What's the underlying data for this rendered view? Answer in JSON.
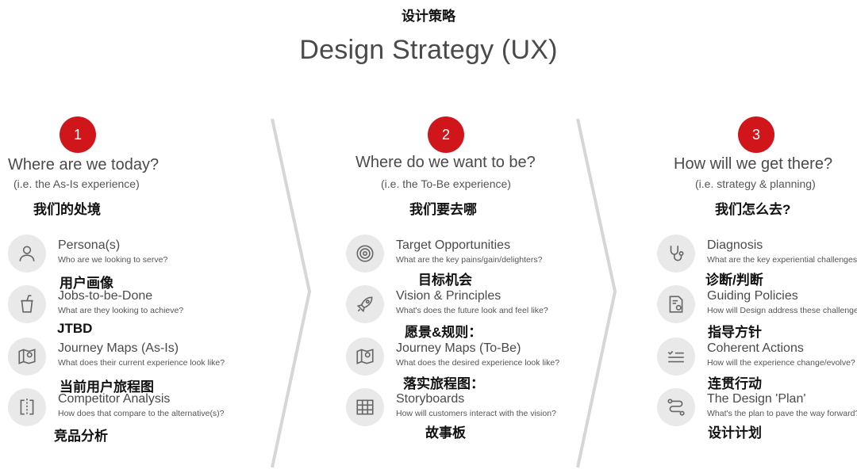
{
  "header": {
    "cn_title": "设计策略",
    "title": "Design Strategy (UX)"
  },
  "columns": [
    {
      "number": "1",
      "title": "Where are we today?",
      "subtitle": "(i.e. the As-Is experience)",
      "cn": "我们的处境",
      "items": [
        {
          "icon": "person-icon",
          "label": "Persona(s)",
          "desc": "Who are we looking to serve?",
          "cn": "用户画像"
        },
        {
          "icon": "cup-icon",
          "label": "Jobs-to-be-Done",
          "desc": "What are they looking to achieve?",
          "cn": "JTBD"
        },
        {
          "icon": "map-pin-icon",
          "label": "Journey Maps (As-Is)",
          "desc": "What does their current experience look like?",
          "cn": "当前用户旅程图"
        },
        {
          "icon": "compare-icon",
          "label": "Competitor Analysis",
          "desc": "How does that compare to the alternative(s)?",
          "cn": "竞品分析"
        }
      ]
    },
    {
      "number": "2",
      "title": "Where do we want to be?",
      "subtitle": "(i.e. the To-Be experience)",
      "cn": "我们要去哪",
      "items": [
        {
          "icon": "target-icon",
          "label": "Target Opportunities",
          "desc": "What are the key pains/gain/delighters?",
          "cn": "目标机会"
        },
        {
          "icon": "rocket-icon",
          "label": "Vision & Principles",
          "desc": "What's does the future look and feel like?",
          "cn": "愿景&规则："
        },
        {
          "icon": "map-pin-icon",
          "label": "Journey Maps (To-Be)",
          "desc": "What does the desired experience look like?",
          "cn": "落实旅程图："
        },
        {
          "icon": "grid-icon",
          "label": "Storyboards",
          "desc": "How will customers interact with the vision?",
          "cn": "故事板"
        }
      ]
    },
    {
      "number": "3",
      "title": "How will we get there?",
      "subtitle": "(i.e. strategy & planning)",
      "cn": "我们怎么去?",
      "items": [
        {
          "icon": "stethoscope-icon",
          "label": "Diagnosis",
          "desc": "What are the key experiential challenges?",
          "cn": "诊断/判断"
        },
        {
          "icon": "policy-doc-icon",
          "label": "Guiding Policies",
          "desc": "How will Design address these challenges?",
          "cn": "指导方针"
        },
        {
          "icon": "checklist-icon",
          "label": "Coherent Actions",
          "desc": "How will the experience change/evolve?",
          "cn": "连贯行动"
        },
        {
          "icon": "route-icon",
          "label": "The Design 'Plan'",
          "desc": "What's the plan to pave the way forward?",
          "cn": "设计计划"
        }
      ]
    }
  ],
  "colors": {
    "accent": "#d1161b",
    "text": "#4a4a4a",
    "icon_bg": "#e9e9e9",
    "divider": "#d6d6d6"
  }
}
